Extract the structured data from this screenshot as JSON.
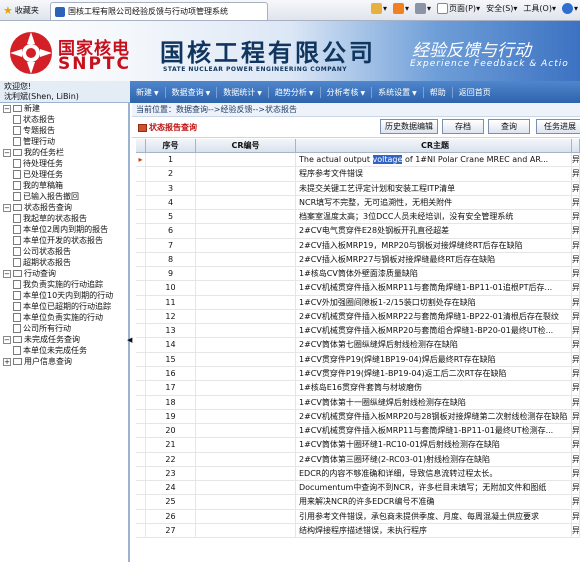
{
  "browser": {
    "favorites": "收藏夹",
    "tab_title": "国核工程有限公司经验反馈与行动项管理系统",
    "page_menu": "页面(P)",
    "safety_menu": "安全(S)",
    "tools_menu": "工具(O)"
  },
  "banner": {
    "cn_logo": "国家核电",
    "en_logo": "SNPTC",
    "company_cn": "国核工程有限公司",
    "company_en": "STATE NUCLEAR POWER ENGINEERING COMPANY",
    "system_cn": "经验反馈与行动",
    "system_en": "Experience Feedback & Actio"
  },
  "user": {
    "welcome": "欢迎您!",
    "name": "沈利斌(Shen, LiBin)"
  },
  "menu": [
    {
      "label": "新建",
      "dropdown": true
    },
    {
      "label": "数据查询",
      "dropdown": true
    },
    {
      "label": "数据统计",
      "dropdown": true
    },
    {
      "label": "趋势分析",
      "dropdown": true
    },
    {
      "label": "分析考核",
      "dropdown": true
    },
    {
      "label": "系统设置",
      "dropdown": true
    },
    {
      "label": "帮助",
      "dropdown": false
    },
    {
      "label": "返回首页",
      "dropdown": false
    }
  ],
  "sidebar": [
    {
      "label": "新建",
      "items": [
        "状态报告",
        "专题报告",
        "管理行动"
      ]
    },
    {
      "label": "我的任务栏",
      "items": [
        "待处理任务",
        "已处理任务",
        "我的草稿箱",
        "已输入报告撤回"
      ]
    },
    {
      "label": "状态报告查询",
      "items": [
        "我起草的状态报告",
        "本单位2周内到期的报告",
        "本单位开发的状态报告",
        "公司状态报告",
        "超期状态报告"
      ]
    },
    {
      "label": "行动查询",
      "items": [
        "我负责实施的行动追踪",
        "本单位10天内到期的行动",
        "本单位已超期的行动追踪",
        "本单位负责实施的行动",
        "公司所有行动"
      ]
    },
    {
      "label": "未完成任务查询",
      "items": [
        "本单位未完成任务"
      ]
    },
    {
      "label": "用户信息查询",
      "items": []
    }
  ],
  "breadcrumb": "当前位置：数据查询-->经验反馈-->状态报告",
  "page_title": "状态报告查询",
  "buttons": {
    "history": "历史数据编辑",
    "save": "存档",
    "query": "查询",
    "task_progress": "任务进展"
  },
  "table": {
    "headers": [
      "序号",
      "CR编号",
      "CR主题",
      ""
    ],
    "rows": [
      {
        "n": "1",
        "cr": "",
        "pre": "The actual output ",
        "hl": "voltage",
        "post": " of 1#NI Polar Crane MREC and AR...",
        "s": "异"
      },
      {
        "n": "2",
        "cr": "",
        "pre": "程序参考文件错误",
        "hl": "",
        "post": "",
        "s": "异"
      },
      {
        "n": "3",
        "cr": "",
        "pre": "未提交关键工艺评定计划和安装工程ITP清单",
        "hl": "",
        "post": "",
        "s": "异"
      },
      {
        "n": "4",
        "cr": "",
        "pre": "NCR填写不完整，无可追溯性，无相关附件",
        "hl": "",
        "post": "",
        "s": "异"
      },
      {
        "n": "5",
        "cr": "",
        "pre": "档案室温度太高；3位DCC人员未经培训，没有安全管理系统",
        "hl": "",
        "post": "",
        "s": "异"
      },
      {
        "n": "6",
        "cr": "",
        "pre": "2#CV电气贯穿件E28处钢板开孔直径超差",
        "hl": "",
        "post": "",
        "s": "异"
      },
      {
        "n": "7",
        "cr": "",
        "pre": "2#CV插入板MRP19，MRP20与钢板对接焊缝终RT后存在缺陷",
        "hl": "",
        "post": "",
        "s": "异"
      },
      {
        "n": "8",
        "cr": "",
        "pre": "2#CV插入板MRP27与钢板对接焊缝最终RT后存在缺陷",
        "hl": "",
        "post": "",
        "s": "异"
      },
      {
        "n": "9",
        "cr": "",
        "pre": "1#核岛CV筒体外壁面漆质量缺陷",
        "hl": "",
        "post": "",
        "s": "异"
      },
      {
        "n": "10",
        "cr": "",
        "pre": "1#CV机械贯穿件插入板MRP11与套筒角焊缝1-BP11-01追根PT后存...",
        "hl": "",
        "post": "",
        "s": "异"
      },
      {
        "n": "11",
        "cr": "",
        "pre": "1#CV外加强圈间隙板1-2/15装口切割处存在缺陷",
        "hl": "",
        "post": "",
        "s": "异"
      },
      {
        "n": "12",
        "cr": "",
        "pre": "2#CV机械贯穿件插入板MRP22与套筒角焊缝1-BP22-01清根后存在裂纹",
        "hl": "",
        "post": "",
        "s": "异"
      },
      {
        "n": "13",
        "cr": "",
        "pre": "1#CV机械贯穿件插入板MRP20与套筒组合焊缝1-BP20-01最终UT检...",
        "hl": "",
        "post": "",
        "s": "异"
      },
      {
        "n": "14",
        "cr": "",
        "pre": "2#CV筒体第七圈纵缝焊后射线检测存在缺陷",
        "hl": "",
        "post": "",
        "s": "异"
      },
      {
        "n": "15",
        "cr": "",
        "pre": "1#CV贯穿件P19(焊缝1BP19-04)焊后最终RT存在缺陷",
        "hl": "",
        "post": "",
        "s": "异"
      },
      {
        "n": "16",
        "cr": "",
        "pre": "1#CV贯穿件P19(焊缝1-BP19-04)返工后二次RT存在缺陷",
        "hl": "",
        "post": "",
        "s": "异"
      },
      {
        "n": "17",
        "cr": "",
        "pre": "1#核岛E16贯穿件套筒与材坡磨伤",
        "hl": "",
        "post": "",
        "s": "异"
      },
      {
        "n": "18",
        "cr": "",
        "pre": "1#CV筒体第十一圈纵缝焊后射线检测存在缺陷",
        "hl": "",
        "post": "",
        "s": "异"
      },
      {
        "n": "19",
        "cr": "",
        "pre": "2#CV机械贯穿件插入板MRP20与28钢板对接焊缝第二次射线检测存在缺陷",
        "hl": "",
        "post": "",
        "s": "异"
      },
      {
        "n": "20",
        "cr": "",
        "pre": "1#CV机械贯穿件插入板MRP11与套筒焊缝1-BP11-01最终UT检测存...",
        "hl": "",
        "post": "",
        "s": "异"
      },
      {
        "n": "21",
        "cr": "",
        "pre": "1#CV筒体第十圈环缝1-RC10-01焊后射线检测存在缺陷",
        "hl": "",
        "post": "",
        "s": "异"
      },
      {
        "n": "22",
        "cr": "",
        "pre": "2#CV筒体第三圈环缝(2-RC03-01)射线检测存在缺陷",
        "hl": "",
        "post": "",
        "s": "异"
      },
      {
        "n": "23",
        "cr": "",
        "pre": "EDCR的内容不够准确和详细，导致信息流转过程太长。",
        "hl": "",
        "post": "",
        "s": "异"
      },
      {
        "n": "24",
        "cr": "",
        "pre": "Documentum中查询不到NCR，许多栏目未填写；无附加文件和图纸",
        "hl": "",
        "post": "",
        "s": "异"
      },
      {
        "n": "25",
        "cr": "",
        "pre": "用来解决NCR的许多EDCR编号不准确",
        "hl": "",
        "post": "",
        "s": "异"
      },
      {
        "n": "26",
        "cr": "",
        "pre": "引用参考文件错误，承包商未提供季度、月度、每周混凝土供应要求",
        "hl": "",
        "post": "",
        "s": "异"
      },
      {
        "n": "27",
        "cr": "",
        "pre": "结构焊接程序描述错误，未执行程序",
        "hl": "",
        "post": "",
        "s": "异"
      }
    ]
  },
  "colors": {
    "menubar": "#2d64ad",
    "brand_red": "#c8101d",
    "selection": "#3163c5"
  }
}
